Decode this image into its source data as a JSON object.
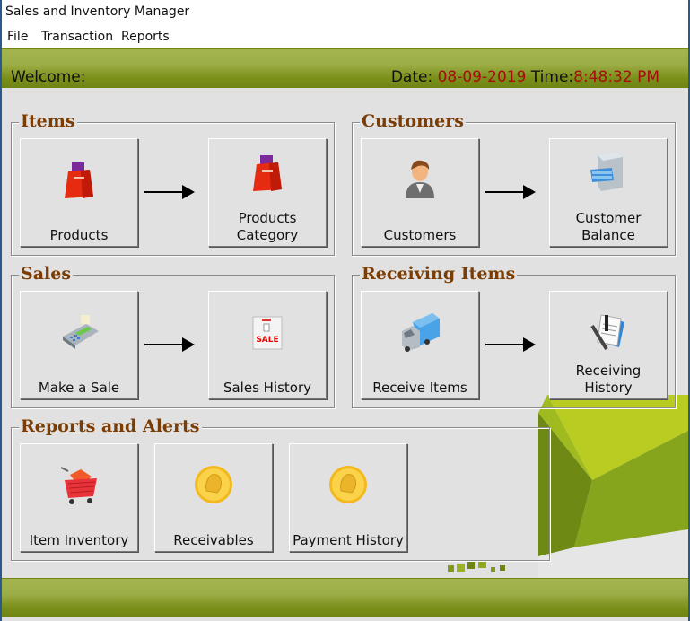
{
  "window": {
    "title": "Sales and Inventory Manager"
  },
  "menu": [
    {
      "label": "File"
    },
    {
      "label": "Transaction"
    },
    {
      "label": "Reports"
    }
  ],
  "header": {
    "welcome": "Welcome:",
    "date_label": "Date:",
    "date_value": "08-09-2019",
    "time_label": "Time:",
    "time_value": "8:48:32 PM"
  },
  "groups": {
    "items": {
      "title": "Items",
      "buttons": [
        {
          "label": "Products",
          "icon": "shopping-bag-icon"
        },
        {
          "label": "Products Category",
          "line1": "Products",
          "line2": "Category",
          "icon": "shopping-bag-icon"
        }
      ]
    },
    "customers": {
      "title": "Customers",
      "buttons": [
        {
          "label": "Customers",
          "icon": "user-icon"
        },
        {
          "label": "Customer Balance",
          "line1": "Customer",
          "line2": "Balance",
          "icon": "file-cabinet-icon"
        }
      ]
    },
    "sales": {
      "title": "Sales",
      "buttons": [
        {
          "label": "Make a Sale",
          "icon": "card-terminal-icon"
        },
        {
          "label": "Sales History",
          "icon": "sale-sign-icon",
          "sign_text": "SALE"
        }
      ]
    },
    "receiving": {
      "title": "Receiving Items",
      "buttons": [
        {
          "label": "Receive Items",
          "icon": "truck-icon"
        },
        {
          "label": "Receiving History",
          "icon": "document-pen-icon"
        }
      ]
    },
    "reports": {
      "title": "Reports and Alerts",
      "buttons": [
        {
          "label": "Item Inventory",
          "icon": "cart-icon"
        },
        {
          "label": "Receivables",
          "icon": "coin-icon"
        },
        {
          "label": "Payment History",
          "icon": "coin-icon"
        }
      ]
    }
  },
  "colors": {
    "accent_green": "#7a8f19",
    "legend_brown": "#7a3d05",
    "date_red": "#a50d0d"
  }
}
